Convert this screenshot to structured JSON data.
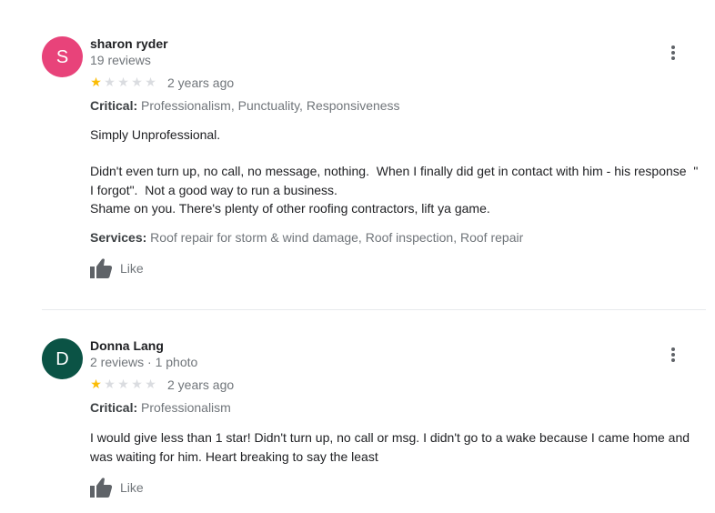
{
  "reviews": [
    {
      "avatar_letter": "S",
      "avatar_color": "#e8437a",
      "name": "sharon ryder",
      "meta": "19 reviews",
      "rating": 1,
      "max_rating": 5,
      "date": "2 years ago",
      "critical_label": "Critical:",
      "critical_value": "Professionalism, Punctuality, Responsiveness",
      "text_paragraphs": [
        "Simply Unprofessional.",
        "Didn't even turn up, no call, no message, nothing.  When I finally did get in contact with him - his response  \" I forgot\".  Not a good way to run a business.\nShame on you. There's plenty of other roofing contractors, lift ya game."
      ],
      "services_label": "Services:",
      "services_value": "Roof repair for storm & wind damage, Roof inspection, Roof repair",
      "like_label": "Like",
      "more_icon": "more-vert-icon"
    },
    {
      "avatar_letter": "D",
      "avatar_color": "#0b5345",
      "name": "Donna Lang",
      "meta": "2 reviews · 1 photo",
      "rating": 1,
      "max_rating": 5,
      "date": "2 years ago",
      "critical_label": "Critical:",
      "critical_value": "Professionalism",
      "text_paragraphs": [
        "I would give less than 1 star! Didn't turn up, no call or msg. I didn't go to a wake because I came home and was waiting for him. Heart breaking to say the least"
      ],
      "like_label": "Like",
      "more_icon": "more-vert-icon"
    }
  ]
}
